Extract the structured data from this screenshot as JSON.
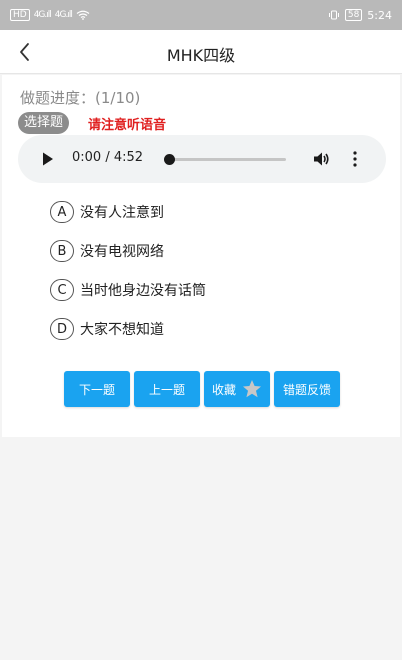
{
  "statusbar": {
    "left_hd": "HD",
    "left_sig1": "4G.ıll",
    "left_sig2": "4G.ıll",
    "battery": "58",
    "time": "5:24"
  },
  "header": {
    "title": "MHK四级"
  },
  "question": {
    "progress": "做题进度：(1/10)",
    "type_badge": "选择题",
    "hint": "请注意听语音"
  },
  "player": {
    "time": "0:00 / 4:52",
    "progress_fraction": 0
  },
  "options": [
    {
      "letter": "A",
      "text": "没有人注意到"
    },
    {
      "letter": "B",
      "text": "没有电视网络"
    },
    {
      "letter": "C",
      "text": "当时他身边没有话筒"
    },
    {
      "letter": "D",
      "text": "大家不想知道"
    }
  ],
  "buttons": {
    "next": "下一题",
    "prev": "上一题",
    "favorite": "收藏",
    "feedback": "错题反馈"
  },
  "colors": {
    "accent": "#1aa3f0",
    "hint": "#e02020",
    "badge": "#8c8c8c"
  }
}
